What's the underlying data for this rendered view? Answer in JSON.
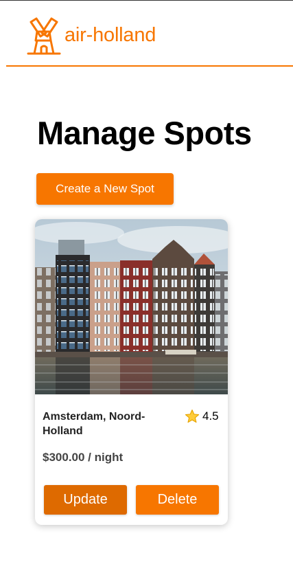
{
  "header": {
    "brand_name": "air-holland",
    "logo_icon": "windmill-icon",
    "accent_color": "#f77600"
  },
  "main": {
    "title": "Manage Spots",
    "create_button_label": "Create a New Spot"
  },
  "spots": [
    {
      "location": "Amsterdam, Noord-Holland",
      "rating": "4.5",
      "price": "$300.00 / night",
      "image_alt": "Amsterdam canal houses",
      "update_label": "Update",
      "delete_label": "Delete"
    }
  ],
  "colors": {
    "primary": "#f77600",
    "primary_dark": "#de6a00"
  }
}
